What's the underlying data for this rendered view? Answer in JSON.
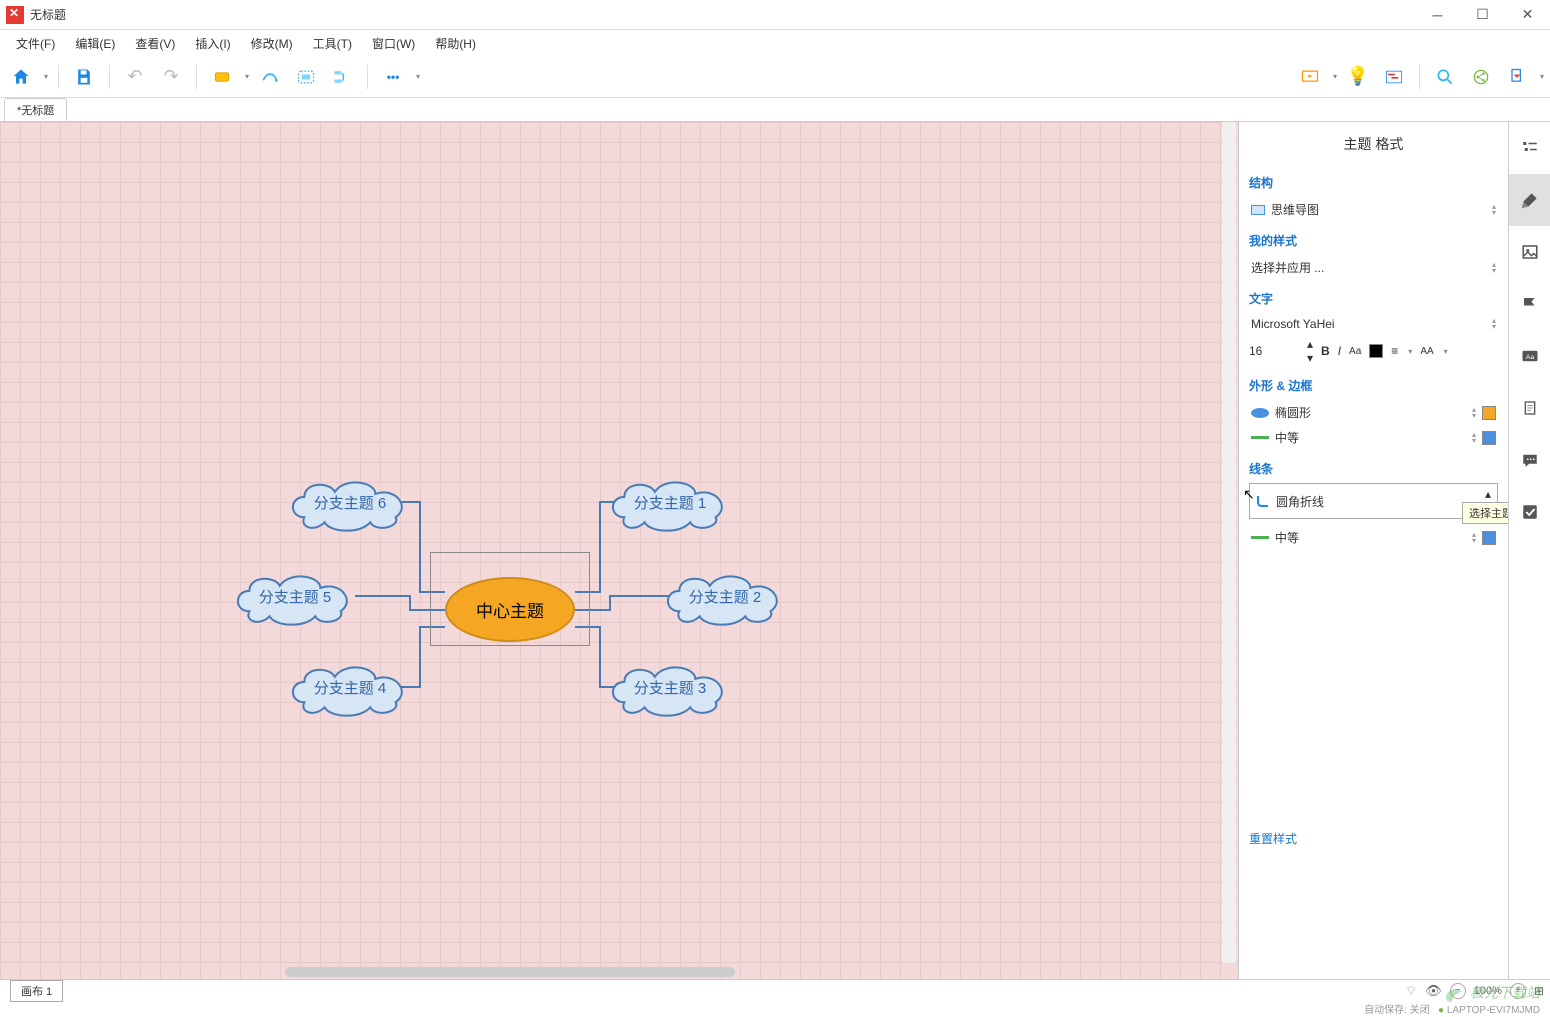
{
  "titlebar": {
    "title": "无标题"
  },
  "menubar": {
    "items": [
      "文件(F)",
      "编辑(E)",
      "查看(V)",
      "插入(I)",
      "修改(M)",
      "工具(T)",
      "窗口(W)",
      "帮助(H)"
    ]
  },
  "tabbar": {
    "tab0": "*无标题"
  },
  "mindmap": {
    "center": "中心主题",
    "b1": "分支主题 1",
    "b2": "分支主题 2",
    "b3": "分支主题 3",
    "b4": "分支主题 4",
    "b5": "分支主题 5",
    "b6": "分支主题 6"
  },
  "panel": {
    "title": "主题 格式",
    "structure_head": "结构",
    "structure_val": "思维导图",
    "style_head": "我的样式",
    "style_val": "选择并应用 ...",
    "text_head": "文字",
    "font_family": "Microsoft YaHei",
    "font_size": "16",
    "shape_head": "外形 & 边框",
    "shape_val": "椭圆形",
    "border_val": "中等",
    "line_head": "线条",
    "line_val": "圆角折线",
    "line_weight": "中等",
    "reset": "重置样式",
    "tooltip": "选择主题同其子主题",
    "shape_color": "#f5a623",
    "border_color": "#4a90e2",
    "text_color": "#000000"
  },
  "statusbar": {
    "canvas": "画布 1",
    "zoom": "100%",
    "autosave": "自动保存: 关闭",
    "host": "LAPTOP-EVI7MJMD"
  },
  "watermark": "极光下载站"
}
